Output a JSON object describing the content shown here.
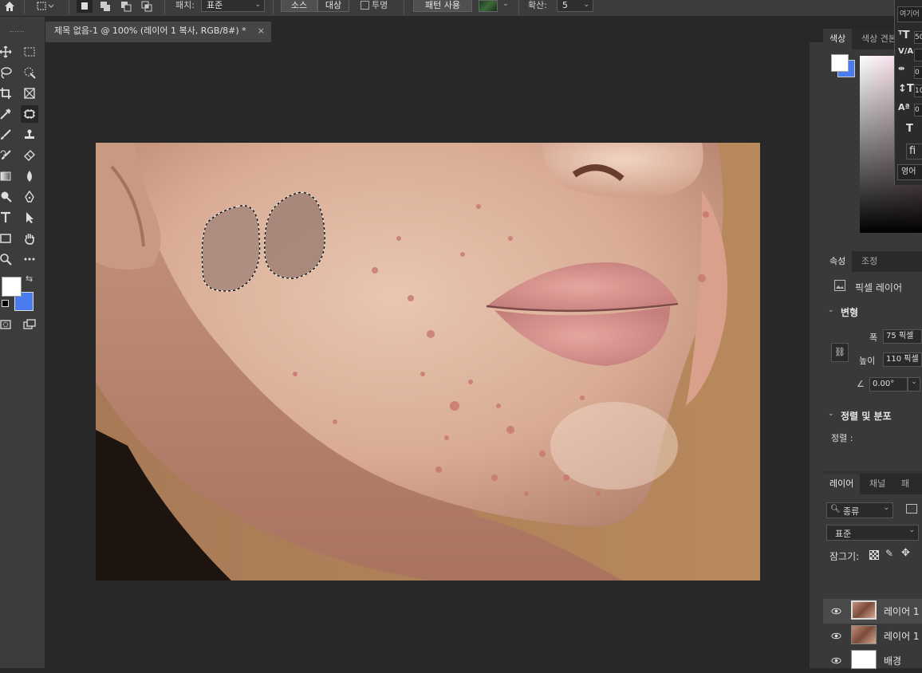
{
  "options_bar": {
    "patch_label": "패치:",
    "patch_value": "표준",
    "source_label": "소스",
    "destination_label": "대상",
    "transparent_label": "투명",
    "use_pattern_label": "패턴 사용",
    "diffusion_label": "확산:",
    "diffusion_value": "5"
  },
  "document_tab": {
    "title": "제목 없음-1 @ 100% (레이어 1 복사, RGB/8#) *",
    "close": "×"
  },
  "color_panel": {
    "tabs": [
      "색상",
      "색상 견본"
    ],
    "foreground": "#ffffff",
    "background": "#4a7cf0"
  },
  "character_panel": {
    "font_placeholder": "여기어",
    "font_size": "50",
    "tracking": "0",
    "leading": "10",
    "baseline": "0",
    "language": "영어"
  },
  "properties_panel": {
    "tabs": [
      "속성",
      "조정"
    ],
    "layer_type": "픽셀 레이어",
    "transform_title": "변형",
    "width_label": "폭",
    "width_value": "75 픽셀",
    "height_label": "높이",
    "height_value": "110 픽셀",
    "angle_value": "0.00°",
    "align_title": "정렬 및 분포",
    "align_label": "정렬 :"
  },
  "layers_panel": {
    "tabs": [
      "레이어",
      "채널",
      "패스"
    ],
    "filter_kind": "종류",
    "blend_mode": "표준",
    "lock_label": "잠그기:",
    "layers": [
      {
        "name": "레이어 1"
      },
      {
        "name": "레이어 1"
      },
      {
        "name": "배경"
      }
    ]
  }
}
